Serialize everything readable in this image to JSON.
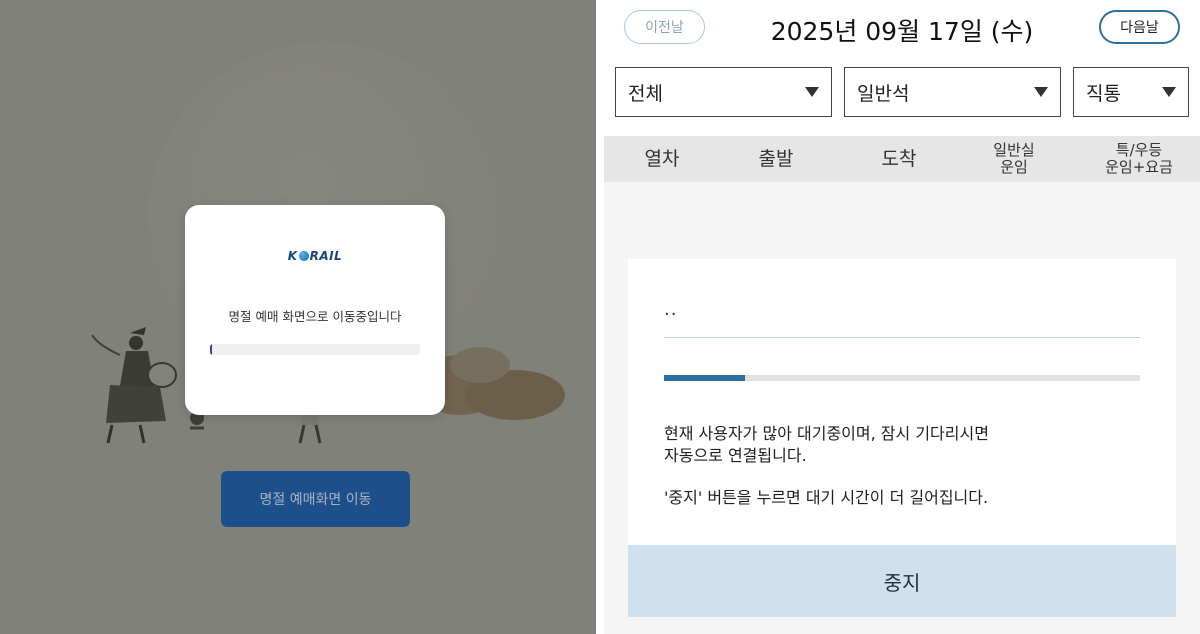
{
  "left": {
    "modal": {
      "logo": {
        "pre": "K",
        "post": "RAIL"
      },
      "message": "명절 예매 화면으로 이동중입니다",
      "progress": 0.01
    },
    "go_button_label": "명절 예매화면 이동"
  },
  "right": {
    "prev_day_label": "이전날",
    "date_title": "2025년 09월 17일 (수)",
    "next_day_label": "다음날",
    "filters": [
      {
        "value": "전체"
      },
      {
        "value": "일반석"
      },
      {
        "value": "직통"
      }
    ],
    "columns": [
      {
        "line1": "열차",
        "line2": ""
      },
      {
        "line1": "출발",
        "line2": ""
      },
      {
        "line1": "도착",
        "line2": ""
      },
      {
        "line1": "일반실",
        "line2": "운임"
      },
      {
        "line1": "특/우등",
        "line2": "운임+요금"
      }
    ],
    "waiting": {
      "dots": "..",
      "progress": 0.17,
      "message_line1": "현재 사용자가 많아 대기중이며, 잠시 기다리시면",
      "message_line2": "자동으로 연결됩니다.",
      "stop_note": "'중지' 버튼을 누르면 대기 시간이 더 길어집니다.",
      "stop_label": "중지"
    }
  }
}
